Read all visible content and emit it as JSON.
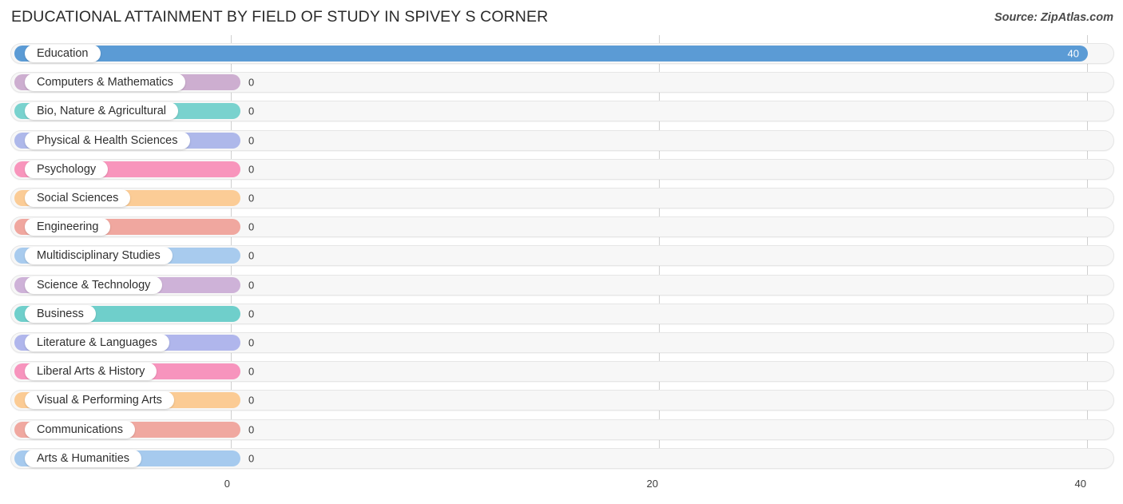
{
  "header": {
    "title": "EDUCATIONAL ATTAINMENT BY FIELD OF STUDY IN SPIVEY S CORNER",
    "source": "Source: ZipAtlas.com"
  },
  "chart_data": {
    "type": "bar",
    "orientation": "horizontal",
    "title": "EDUCATIONAL ATTAINMENT BY FIELD OF STUDY IN SPIVEY S CORNER",
    "xlabel": "",
    "ylabel": "",
    "xlim": [
      0,
      40
    ],
    "grid": true,
    "legend": "none",
    "ticks": [
      {
        "label": "0",
        "value": 0
      },
      {
        "label": "20",
        "value": 20
      },
      {
        "label": "40",
        "value": 40
      }
    ],
    "categories": [
      "Education",
      "Computers & Mathematics",
      "Bio, Nature & Agricultural",
      "Physical & Health Sciences",
      "Psychology",
      "Social Sciences",
      "Engineering",
      "Multidisciplinary Studies",
      "Science & Technology",
      "Business",
      "Literature & Languages",
      "Liberal Arts & History",
      "Visual & Performing Arts",
      "Communications",
      "Arts & Humanities"
    ],
    "values": [
      40,
      0,
      0,
      0,
      0,
      0,
      0,
      0,
      0,
      0,
      0,
      0,
      0,
      0,
      0
    ],
    "value_labels": [
      "40",
      "0",
      "0",
      "0",
      "0",
      "0",
      "0",
      "0",
      "0",
      "0",
      "0",
      "0",
      "0",
      "0",
      "0"
    ],
    "colors": [
      "#5b9bd5",
      "#cdaed0",
      "#79d2ce",
      "#aeb8ea",
      "#f895bc",
      "#fbcc96",
      "#f0a79f",
      "#a8cbee",
      "#ceb2d8",
      "#6fcfcb",
      "#b0b6ec",
      "#f794bd",
      "#fbcb94",
      "#f0a8a0",
      "#a6caee"
    ]
  }
}
